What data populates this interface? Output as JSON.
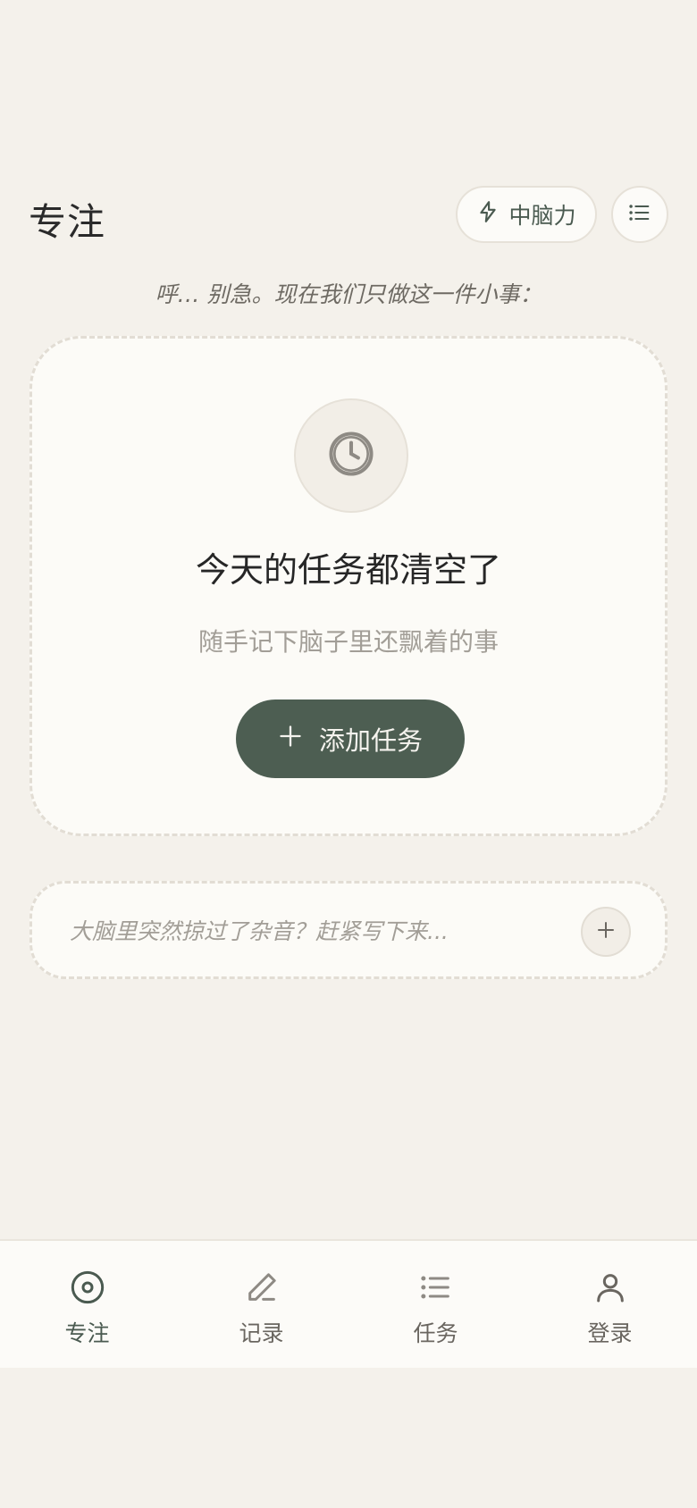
{
  "header": {
    "title": "专注",
    "energy_label": "中脑力",
    "energy_icon": "lightning-icon",
    "menu_icon": "list-icon"
  },
  "subtitle": "呼… 别急。现在我们只做这一件小事：",
  "focus_card": {
    "icon": "clock-icon",
    "title": "今天的任务都清空了",
    "subtitle": "随手记下脑子里还飘着的事",
    "add_button_label": "添加任务"
  },
  "quick_capture": {
    "value": "",
    "placeholder": "大脑里突然掠过了杂音？赶紧写下来..."
  },
  "bottom_nav": {
    "items": [
      {
        "label": "专注",
        "icon": "focus-target-icon",
        "active": true
      },
      {
        "label": "记录",
        "icon": "pencil-icon",
        "active": false
      },
      {
        "label": "任务",
        "icon": "list-icon",
        "active": false
      },
      {
        "label": "登录",
        "icon": "user-icon",
        "active": false
      }
    ]
  },
  "colors": {
    "background": "#f4f1eb",
    "card": "#fcfbf7",
    "accent": "#4d5e52",
    "muted_text": "#a29e97"
  }
}
